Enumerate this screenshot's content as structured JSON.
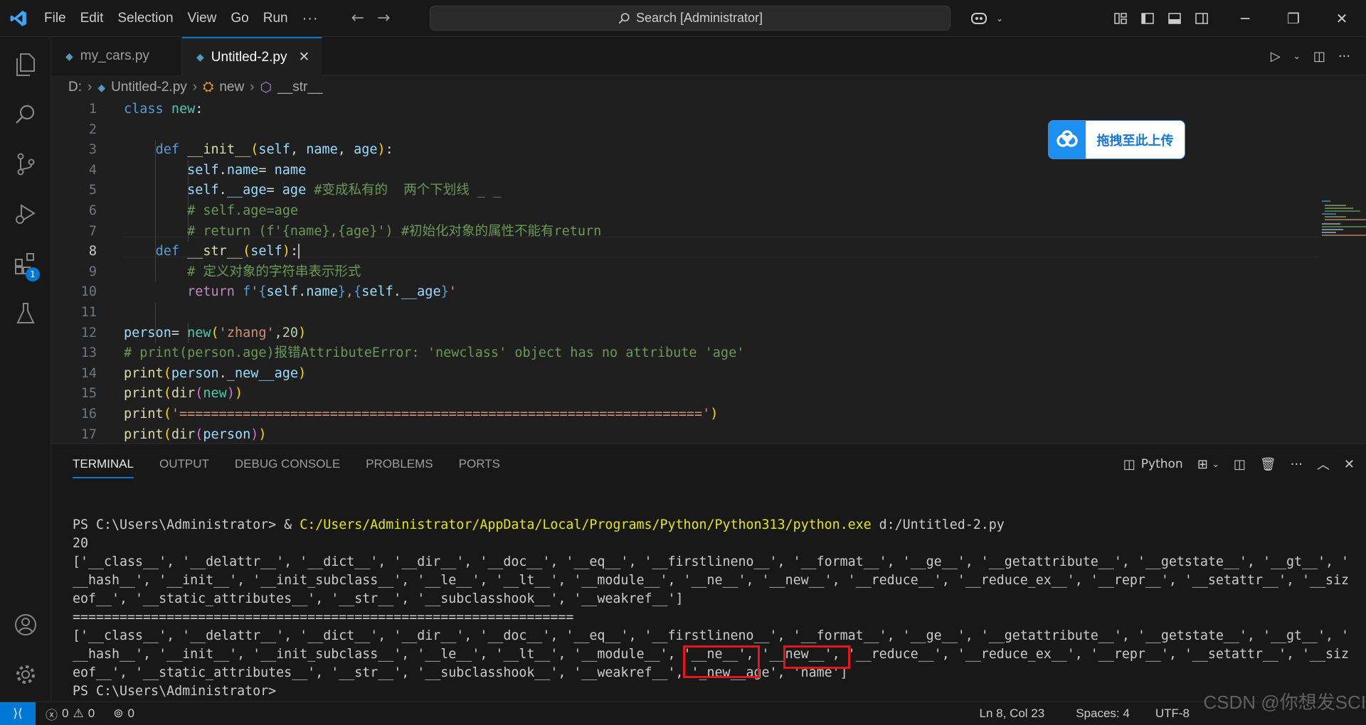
{
  "menu": [
    "File",
    "Edit",
    "Selection",
    "View",
    "Go",
    "Run",
    "···"
  ],
  "search": {
    "label": "Search [Administrator]"
  },
  "tabs": [
    {
      "label": "my_cars.py",
      "active": false
    },
    {
      "label": "Untitled-2.py",
      "active": true
    }
  ],
  "breadcrumb": [
    "D:",
    "Untitled-2.py",
    "new",
    "__str__"
  ],
  "editor": {
    "lines": [
      {
        "n": "1"
      },
      {
        "n": "2"
      },
      {
        "n": "3"
      },
      {
        "n": "4"
      },
      {
        "n": "5"
      },
      {
        "n": "6"
      },
      {
        "n": "7"
      },
      {
        "n": "8"
      },
      {
        "n": "9"
      },
      {
        "n": "10"
      },
      {
        "n": "11"
      },
      {
        "n": "12"
      },
      {
        "n": "13"
      },
      {
        "n": "14"
      },
      {
        "n": "15"
      },
      {
        "n": "16"
      },
      {
        "n": "17"
      }
    ],
    "current_line": "8"
  },
  "upload_widget": {
    "label": "拖拽至此上传"
  },
  "panel": {
    "tabs": [
      "TERMINAL",
      "OUTPUT",
      "DEBUG CONSOLE",
      "PROBLEMS",
      "PORTS"
    ],
    "active_tab": "TERMINAL",
    "shell": "Python",
    "terminal_lines": [
      {
        "prefix": "PS C:\\Users\\Administrator> & ",
        "highlight": "C:/Users/Administrator/AppData/Local/Programs/Python/Python313/python.exe",
        "suffix": " d:/Untitled-2.py"
      },
      {
        "text": "20"
      },
      {
        "text": "['__class__', '__delattr__', '__dict__', '__dir__', '__doc__', '__eq__', '__firstlineno__', '__format__', '__ge__', '__getattribute__', '__getstate__', '__gt__', '"
      },
      {
        "text": "__hash__', '__init__', '__init_subclass__', '__le__', '__lt__', '__module__', '__ne__', '__new__', '__reduce__', '__reduce_ex__', '__repr__', '__setattr__', '__siz"
      },
      {
        "text": "eof__', '__static_attributes__', '__str__', '__subclasshook__', '__weakref__']"
      },
      {
        "text": "================================================================"
      },
      {
        "text": "['__class__', '__delattr__', '__dict__', '__dir__', '__doc__', '__eq__', '__firstlineno__', '__format__', '__ge__', '__getattribute__', '__getstate__', '__gt__', '"
      },
      {
        "text": "__hash__', '__init__', '__init_subclass__', '__le__', '__lt__', '__module__', '__ne__', '__new__', '__reduce__', '__reduce_ex__', '__repr__', '__setattr__', '__siz"
      },
      {
        "text": "eof__', '__static_attributes__', '__str__', '__subclasshook__', '__weakref__', '_new__age', 'name']"
      },
      {
        "text": "PS C:\\Users\\Administrator> "
      }
    ]
  },
  "status": {
    "errors": "0",
    "warnings": "0",
    "ports": "0",
    "position": "Ln 8, Col 23",
    "spaces": "Spaces: 4",
    "encoding": "UTF-8",
    "extensions_badge": "1"
  },
  "watermark": "CSDN @你想发SCI",
  "colors": {
    "accent": "#0078d4",
    "highlight_box": "#e8131b"
  }
}
